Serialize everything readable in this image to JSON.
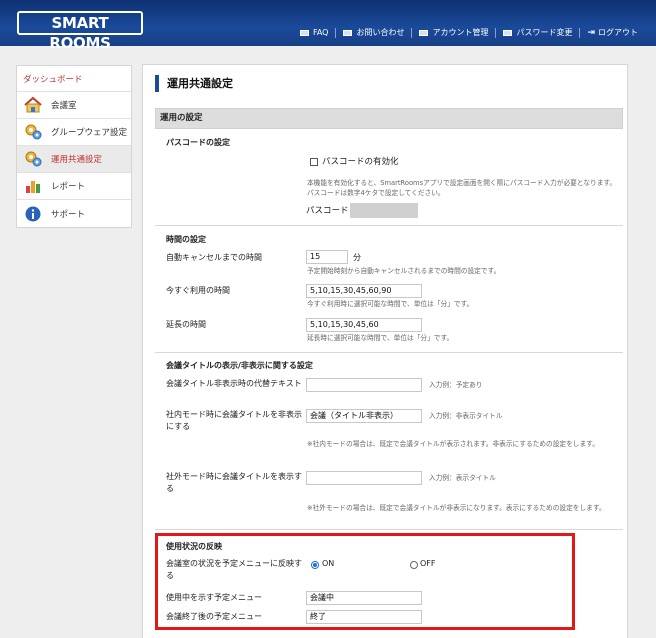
{
  "header": {
    "logo": "SMART ROOMS",
    "nav": [
      {
        "label": "FAQ",
        "icon": "card-icon"
      },
      {
        "label": "お問い合わせ",
        "icon": "card-icon"
      },
      {
        "label": "アカウント管理",
        "icon": "card-icon"
      },
      {
        "label": "パスワード変更",
        "icon": "card-icon"
      },
      {
        "label": "ログアウト",
        "icon": "logout-icon"
      }
    ]
  },
  "sidebar": {
    "items": [
      {
        "label": "ダッシュボード"
      },
      {
        "label": "会議室",
        "icon": "house-icon"
      },
      {
        "label": "グループウェア設定",
        "icon": "gears-icon"
      },
      {
        "label": "運用共通設定",
        "icon": "gears-icon"
      },
      {
        "label": "レポート",
        "icon": "bar-chart-icon"
      },
      {
        "label": "サポート",
        "icon": "info-icon"
      }
    ]
  },
  "main": {
    "title": "運用共通設定",
    "section": "運用の設定",
    "passcode": {
      "title": "パスコードの設定",
      "checkbox_label": "パスコードの有効化",
      "description": "本機能を有効化すると、SmartRoomsアプリで設定画面を開く際にパスコード入力が必要となります。パスコードは数字4ケタで設定してください。",
      "passcode_label": "パスコード"
    },
    "time": {
      "title": "時間の設定",
      "auto_cancel_label": "自動キャンセルまでの時間",
      "auto_cancel_value": "15",
      "auto_cancel_unit": "分",
      "auto_cancel_hint": "予定開始時刻から自動キャンセルされるまでの時間の設定です。",
      "now_use_label": "今すぐ利用の時間",
      "now_use_value": "5,10,15,30,45,60,90",
      "now_use_hint": "今すぐ利用時に選択可能な時間で、単位は「分」です。",
      "extend_label": "延長の時間",
      "extend_value": "5,10,15,30,45,60",
      "extend_hint": "延長時に選択可能な時間で、単位は「分」です。"
    },
    "meeting_title": {
      "title": "会議タイトルの表示/非表示に関する設定",
      "alt_text_label": "会議タイトル非表示時の代替テキスト",
      "alt_text_value": "",
      "alt_text_example": "入力例：予定あり",
      "internal_label": "社内モード時に会議タイトルを非表示にする",
      "internal_value": "会議（タイトル非表示）",
      "internal_example": "入力例：非表示タイトル",
      "internal_note": "※社内モードの場合は、既定で会議タイトルが表示されます。非表示にするための設定をします。",
      "external_label": "社外モード時に会議タイトルを表示する",
      "external_value": "",
      "external_example": "入力例：表示タイトル",
      "external_note": "※社外モードの場合は、既定で会議タイトルが非表示になります。表示にするための設定をします。"
    },
    "usage": {
      "title": "使用状況の反映",
      "reflect_label": "会議室の状況を予定メニューに反映する",
      "on_label": "ON",
      "off_label": "OFF",
      "selected": "ON",
      "in_use_label": "使用中を示す予定メニュー",
      "in_use_value": "会議中",
      "ended_label": "会議終了後の予定メニュー",
      "ended_value": "終了"
    }
  },
  "colors": {
    "header": "#1a4a9a",
    "accent_red": "#e01818",
    "active_text": "#c03030"
  }
}
